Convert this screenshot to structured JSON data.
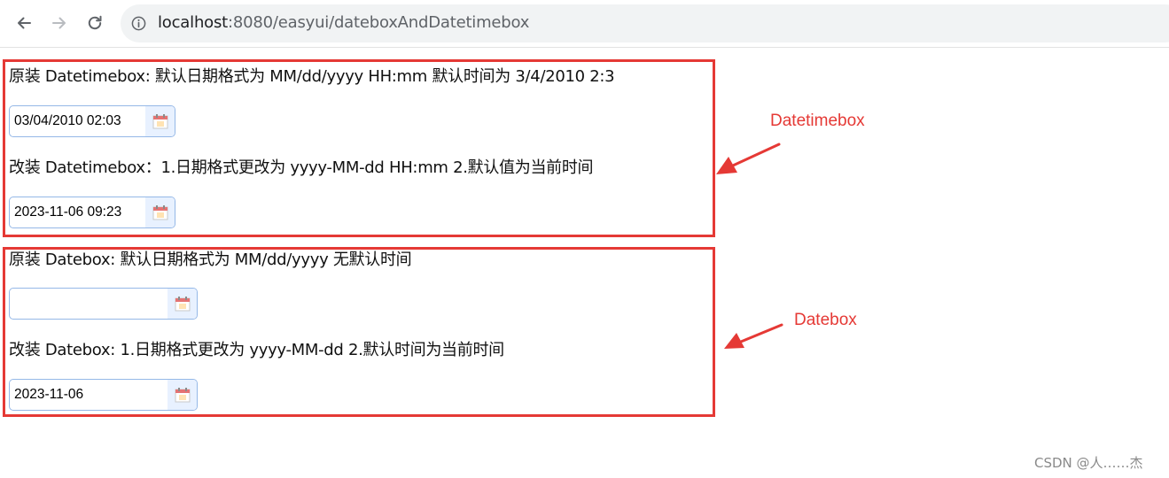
{
  "browser": {
    "url_host": "localhost",
    "url_rest": ":8080/easyui/dateboxAndDatetimebox",
    "back_icon": "back-arrow-icon",
    "forward_icon": "forward-arrow-icon",
    "reload_icon": "reload-icon",
    "site_info_icon": "info-icon"
  },
  "datetimebox_section": {
    "original_label": "原装 Datetimebox: 默认日期格式为 MM/dd/yyyy HH:mm 默认时间为 3/4/2010 2:3",
    "original_value": "03/04/2010 02:03",
    "modified_label": "改装 Datetimebox：1.日期格式更改为 yyyy-MM-dd HH:mm 2.默认值为当前时间",
    "modified_value": "2023-11-06 09:23"
  },
  "datebox_section": {
    "original_label": "原装 Datebox: 默认日期格式为 MM/dd/yyyy 无默认时间",
    "original_value": "",
    "modified_label": "改装 Datebox: 1.日期格式更改为 yyyy-MM-dd 2.默认时间为当前时间",
    "modified_value": "2023-11-06"
  },
  "annotations": {
    "datetimebox": "Datetimebox",
    "datebox": "Datebox",
    "color": "#e53935"
  },
  "watermark": "CSDN @人……杰",
  "colors": {
    "field_border": "#95b8e7",
    "trigger_bg": "#e8f1ff",
    "omnibox_bg": "#f1f3f4"
  }
}
